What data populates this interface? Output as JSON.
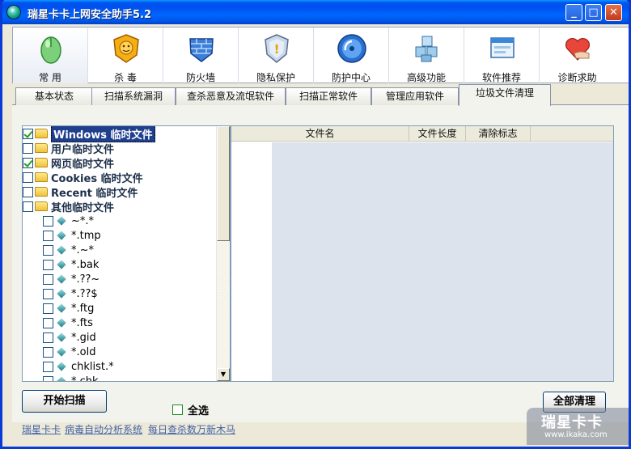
{
  "window": {
    "title": "瑞星卡卡上网安全助手5.2",
    "minimize": "_",
    "maximize": "□",
    "close": "✕"
  },
  "toolbar": [
    {
      "label": "常 用",
      "icon": "mouse-icon"
    },
    {
      "label": "杀 毒",
      "icon": "lion-shield-icon"
    },
    {
      "label": "防火墙",
      "icon": "firewall-icon"
    },
    {
      "label": "隐私保护",
      "icon": "privacy-shield-icon"
    },
    {
      "label": "防护中心",
      "icon": "protection-center-icon"
    },
    {
      "label": "高级功能",
      "icon": "cubes-icon"
    },
    {
      "label": "软件推荐",
      "icon": "software-window-icon"
    },
    {
      "label": "诊断求助",
      "icon": "heart-hand-icon"
    }
  ],
  "tabs": [
    {
      "label": "基本状态"
    },
    {
      "label": "扫描系统漏洞"
    },
    {
      "label": "查杀恶意及流氓软件"
    },
    {
      "label": "扫描正常软件"
    },
    {
      "label": "管理应用软件"
    },
    {
      "label": "垃圾文件清理"
    }
  ],
  "active_tab": "垃圾文件清理",
  "tree": {
    "folders": [
      {
        "label": "Windows 临时文件",
        "checked": true,
        "selected": true
      },
      {
        "label": "用户临时文件",
        "checked": false
      },
      {
        "label": "网页临时文件",
        "checked": true
      },
      {
        "label": "Cookies 临时文件",
        "checked": false
      },
      {
        "label": "Recent 临时文件",
        "checked": false
      },
      {
        "label": "其他临时文件",
        "checked": false
      }
    ],
    "patterns": [
      {
        "label": "~*.*",
        "checked": false
      },
      {
        "label": "*.tmp",
        "checked": false
      },
      {
        "label": "*.~*",
        "checked": false
      },
      {
        "label": "*.bak",
        "checked": false
      },
      {
        "label": "*.??~",
        "checked": false
      },
      {
        "label": "*.??$",
        "checked": false
      },
      {
        "label": "*.ftg",
        "checked": false
      },
      {
        "label": "*.fts",
        "checked": false
      },
      {
        "label": "*.gid",
        "checked": false
      },
      {
        "label": "*.old",
        "checked": false
      },
      {
        "label": "chklist.*",
        "checked": false
      },
      {
        "label": "*.chk",
        "checked": false
      }
    ]
  },
  "list": {
    "columns": [
      "文件名",
      "文件长度",
      "清除标志"
    ]
  },
  "buttons": {
    "scan": "开始扫描",
    "clean_all": "全部清理"
  },
  "select_all": {
    "label": "全选",
    "checked": false
  },
  "status": {
    "link1": "瑞星卡卡",
    "link2": "病毒自动分析系统",
    "link3": "每日查杀数万新木马"
  },
  "watermark": {
    "title": "瑞星卡卡",
    "url": "www.ikaka.com"
  },
  "colors": {
    "title_bar": "#0055e6",
    "selected_bg": "#1f3f8c",
    "link": "#4262a6"
  }
}
